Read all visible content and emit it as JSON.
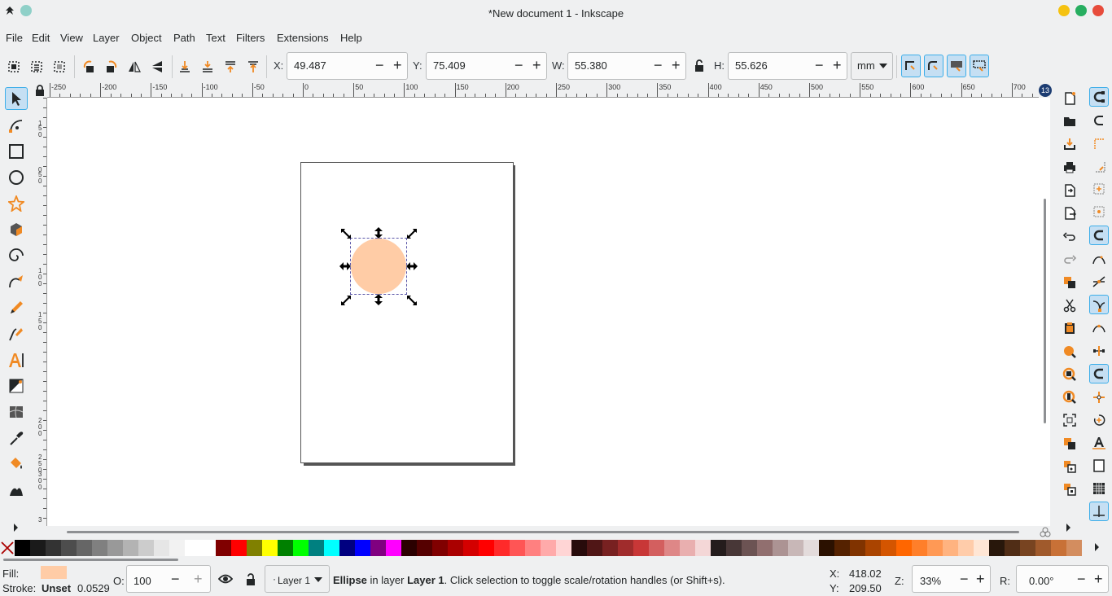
{
  "window": {
    "title": "*New document 1 - Inkscape"
  },
  "menu": [
    "File",
    "Edit",
    "View",
    "Layer",
    "Object",
    "Path",
    "Text",
    "Filters",
    "Extensions",
    "Help"
  ],
  "toolbar": {
    "x_label": "X:",
    "x_value": "49.487",
    "y_label": "Y:",
    "y_value": "75.409",
    "w_label": "W:",
    "w_value": "55.380",
    "h_label": "H:",
    "h_value": "55.626",
    "unit": "mm",
    "minus": "−",
    "plus": "+"
  },
  "ruler_h_labels": [
    "-250",
    "-200",
    "-150",
    "-100",
    "-50",
    "0",
    "50",
    "100",
    "150",
    "200",
    "250",
    "300",
    "350",
    "400",
    "450",
    "500",
    "550",
    "600",
    "650",
    "700"
  ],
  "ruler_v_labels": [
    "1",
    "5",
    "0",
    "0",
    "5",
    "0",
    "1",
    "0",
    "0",
    "1",
    "5",
    "0",
    "2",
    "0",
    "0",
    "2",
    "5",
    "0",
    "3",
    "0",
    "0",
    "3"
  ],
  "corner_badge": "13",
  "statusbar": {
    "fill_label": "Fill:",
    "stroke_label": "Stroke:",
    "stroke_value": "Unset",
    "stroke_width": "0.0529",
    "opacity_label": "O:",
    "opacity_value": "100",
    "layer": "Layer 1",
    "message_strong": "Ellipse",
    "message_mid": " in layer ",
    "message_layer": "Layer 1",
    "message_tail": ". Click selection to toggle scale/rotation handles (or Shift+s).",
    "cursor_x_label": "X:",
    "cursor_x": "418.02",
    "cursor_y_label": "Y:",
    "cursor_y": "209.50",
    "zoom_label": "Z:",
    "zoom_value": "33%",
    "rotate_label": "R:",
    "rotate_value": "0.00°"
  },
  "colors": {
    "ellipse_fill": "#ffcca6",
    "accent": "#3daee9",
    "win_min": "#f5c211",
    "win_max": "#27ae60",
    "win_close": "#e74c3c"
  },
  "palette": [
    "#000000",
    "#1a1a1a",
    "#333333",
    "#4d4d4d",
    "#666666",
    "#808080",
    "#999999",
    "#b3b3b3",
    "#cccccc",
    "#e6e6e6",
    "#f2f2f2",
    "#ffffff",
    "#ffffff",
    "#800000",
    "#ff0000",
    "#808000",
    "#ffff00",
    "#008000",
    "#00ff00",
    "#008080",
    "#00ffff",
    "#000080",
    "#0000ff",
    "#800080",
    "#ff00ff",
    "#2b0000",
    "#550000",
    "#800000",
    "#aa0000",
    "#d40000",
    "#ff0000",
    "#ff2a2a",
    "#ff5555",
    "#ff8080",
    "#ffaaaa",
    "#ffd5d5",
    "#280b0b",
    "#501616",
    "#782121",
    "#a02c2c",
    "#c83737",
    "#d35f5f",
    "#de8787",
    "#e9afaf",
    "#f4d7d7",
    "#241c1c",
    "#483737",
    "#6c5353",
    "#916f6f",
    "#ac9393",
    "#c8b7b7",
    "#e3dbdb",
    "#2b1100",
    "#552200",
    "#803300",
    "#aa4400",
    "#d45500",
    "#ff6600",
    "#ff7f2a",
    "#ff9955",
    "#ffb380",
    "#ffccaa",
    "#ffe6d5",
    "#28170b",
    "#502d16",
    "#784421",
    "#a05a2c",
    "#c87137",
    "#d38d5f"
  ]
}
